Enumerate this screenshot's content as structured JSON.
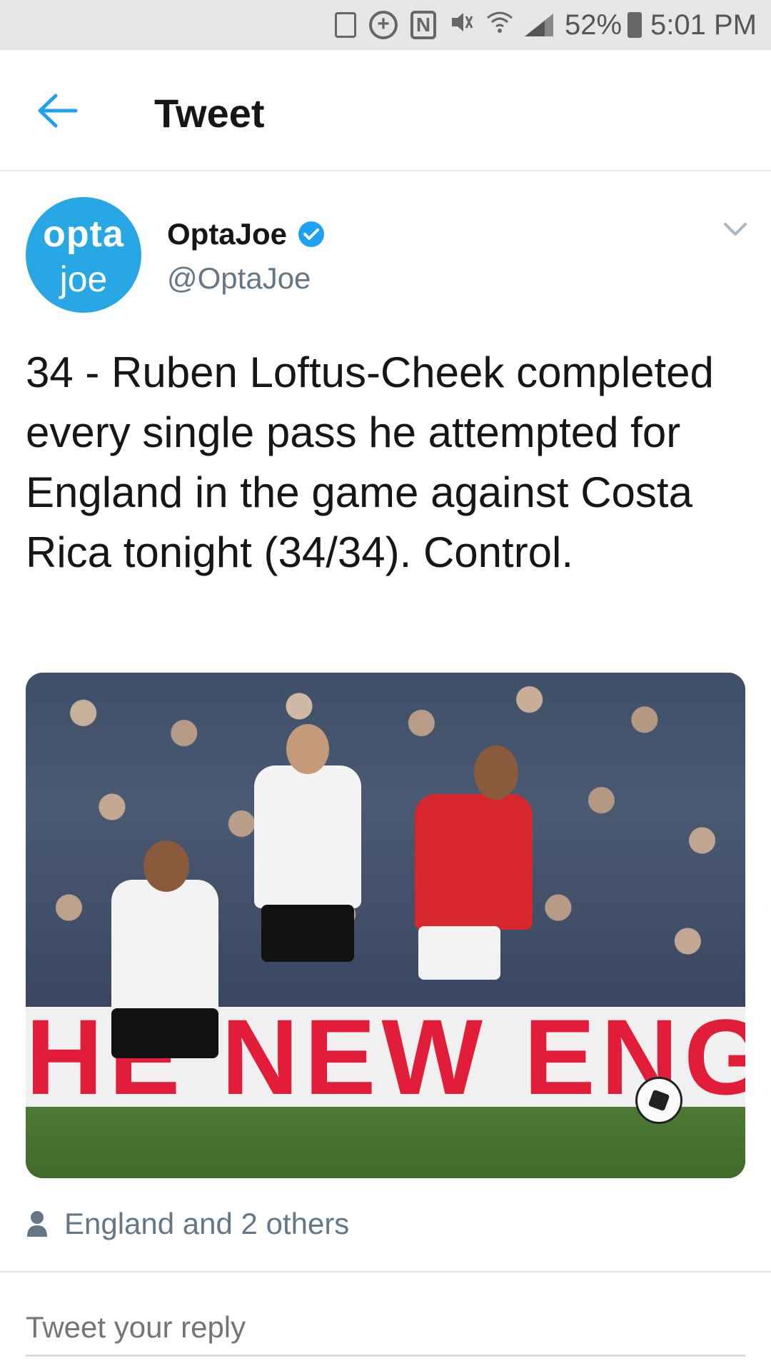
{
  "status_bar": {
    "battery": "52%",
    "time": "5:01 PM"
  },
  "header": {
    "title": "Tweet"
  },
  "tweet": {
    "author_name": "OptaJoe",
    "author_handle": "@OptaJoe",
    "avatar_line1": "opta",
    "avatar_line2": "joe",
    "text": "34 - Ruben Loftus-Cheek completed every single pass he attempted for England in the game against Costa Rica tonight (34/34). Control.",
    "media_banner_text": "HE NEW ENGL",
    "likers": "England and 2 others"
  },
  "reply": {
    "placeholder": "Tweet your reply"
  },
  "colors": {
    "accent": "#1da1f2",
    "avatar_bg": "#27a7e4",
    "muted": "#657786"
  }
}
